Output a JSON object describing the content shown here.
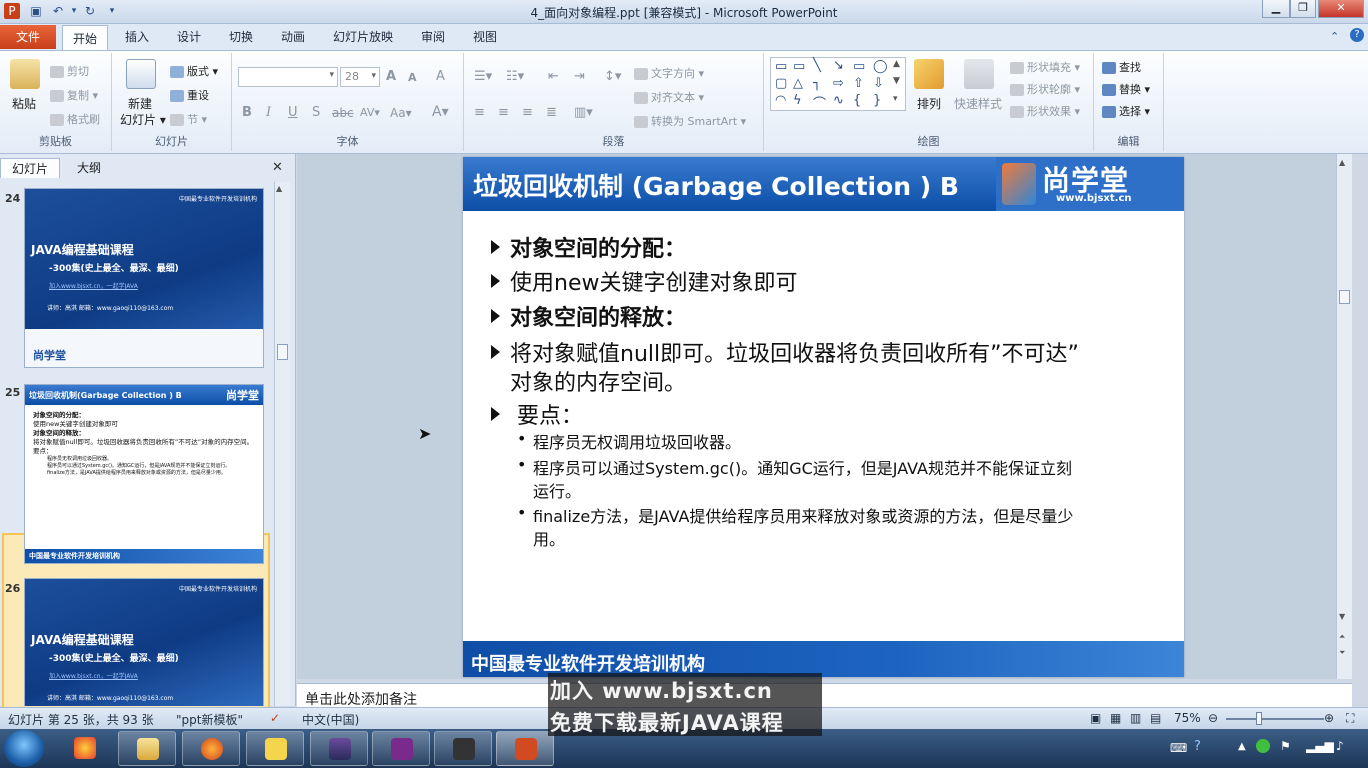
{
  "window": {
    "title": "4_面向对象编程.ppt [兼容模式]  -  Microsoft PowerPoint"
  },
  "tabs": [
    {
      "label": "文件"
    },
    {
      "label": "开始"
    },
    {
      "label": "插入"
    },
    {
      "label": "设计"
    },
    {
      "label": "切换"
    },
    {
      "label": "动画"
    },
    {
      "label": "幻灯片放映"
    },
    {
      "label": "审阅"
    },
    {
      "label": "视图"
    }
  ],
  "ribbon": {
    "clipboard": {
      "label": "剪贴板",
      "paste": "粘贴",
      "cut": "剪切",
      "copy": "复制",
      "format_painter": "格式刷"
    },
    "slides": {
      "label": "幻灯片",
      "new_slide_1": "新建",
      "new_slide_2": "幻灯片",
      "layout": "版式",
      "reset": "重设",
      "section": "节"
    },
    "font": {
      "label": "字体",
      "font_size": "28",
      "bold": "B",
      "italic": "I",
      "underline": "U",
      "shadow": "S",
      "strike": "abc",
      "spacing": "AV",
      "case": "Aa",
      "grow": "A",
      "shrink": "A",
      "clear": "A"
    },
    "paragraph": {
      "label": "段落",
      "text_direction": "文字方向",
      "align_text": "对齐文本",
      "smartart": "转换为 SmartArt"
    },
    "drawing": {
      "label": "绘图",
      "arrange": "排列",
      "quick_styles": "快速样式",
      "shape_fill": "形状填充",
      "shape_outline": "形状轮廓",
      "shape_effects": "形状效果"
    },
    "editing": {
      "label": "编辑",
      "find": "查找",
      "replace": "替换",
      "select": "选择"
    }
  },
  "left_pane": {
    "tab_slides": "幻灯片",
    "tab_outline": "大纲",
    "thumbs": [
      {
        "num": "24",
        "header": "中国最专业软件开发培训机构",
        "title": "JAVA编程基础课程",
        "subtitle": "-300集(史上最全、最深、最细)",
        "link": "加入www.bjsxt.cn，一起学JAVA",
        "lecturer": "讲师：高淇    邮箱：www.gaoqi110@163.com",
        "logo": "尚学堂"
      },
      {
        "num": "25",
        "title": "垃圾回收机制(Garbage Collection ) B",
        "logo": "尚学堂",
        "footer": "中国最专业软件开发培训机构",
        "lines": [
          "对象空间的分配：",
          "使用new关键字创建对象即可",
          "对象空间的释放：",
          "将对象赋值null即可。垃圾回收器将负责回收所有”不可达”对象的内存空间。",
          "要点：",
          "程序员无权调用垃圾回收器。",
          "程序员可以通过System.gc()。通知GC运行，但是JAVA规范并不能保证立刻运行。",
          "finalize方法，是JAVA提供给程序员用来释放对象或资源的方法，但是尽量少用。"
        ]
      },
      {
        "num": "26",
        "header": "中国最专业软件开发培训机构",
        "title": "JAVA编程基础课程",
        "subtitle": "-300集(史上最全、最深、最细)",
        "link": "加入www.bjsxt.cn，一起学JAVA",
        "lecturer": "讲师：高淇    邮箱：www.gaoqi110@163.com"
      }
    ]
  },
  "slide": {
    "title": "垃圾回收机制 (Garbage Collection ) B",
    "logo_cn": "尚学堂",
    "logo_en": "www.bjsxt.cn",
    "bullets": [
      "对象空间的分配：",
      "使用new关键字创建对象即可",
      "对象空间的释放：",
      "将对象赋值null即可。垃圾回收器将负责回收所有”不可达”",
      "对象的内存空间。",
      "要点："
    ],
    "points": [
      "程序员无权调用垃圾回收器。",
      "程序员可以通过System.gc()。通知GC运行，但是JAVA规范并不能保证立刻",
      "运行。",
      "finalize方法，是JAVA提供给程序员用来释放对象或资源的方法，但是尽量少",
      "用。"
    ],
    "footer": "中国最专业软件开发培训机构"
  },
  "notes": {
    "placeholder": "单击此处添加备注"
  },
  "status": {
    "slide_count": "幻灯片 第 25 张，共 93 张",
    "theme": "\"ppt新模板\"",
    "language": "中文(中国)",
    "zoom": "75%"
  },
  "watermark": {
    "line1": "加入 www.bjsxt.cn",
    "line2": "免费下载最新JAVA课程"
  },
  "colors": {
    "slide_blue": "#0c4ea6",
    "file_tab": "#d24a22",
    "selection": "#f2c45a"
  }
}
